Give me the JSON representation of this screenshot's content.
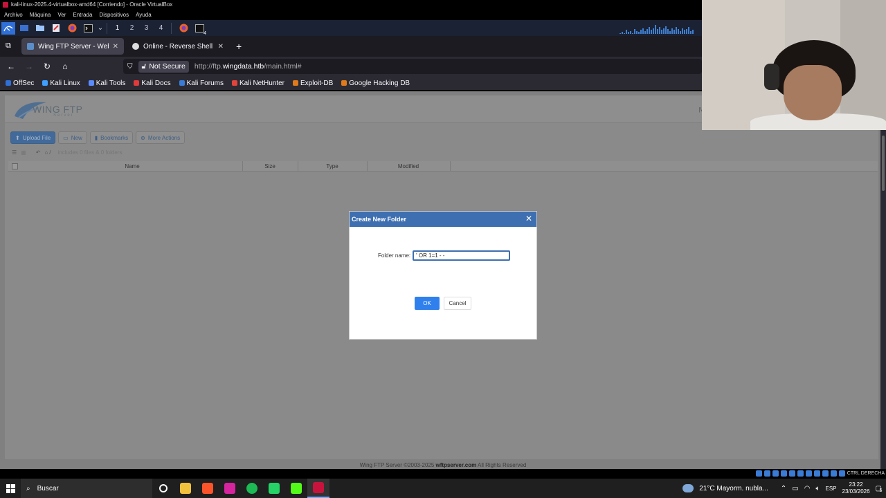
{
  "vbox": {
    "title": "kali-linux-2025.4-virtualbox-amd64 [Corriendo] - Oracle VirtualBox",
    "menu": [
      "Archivo",
      "Máquina",
      "Ver",
      "Entrada",
      "Dispositivos",
      "Ayuda"
    ]
  },
  "kali_panel": {
    "workspaces": [
      "1",
      "2",
      "3",
      "4"
    ],
    "terminal_badge": "4",
    "graph_levels": [
      0.1,
      0.2,
      0.1,
      0.4,
      0.2,
      0.3,
      0.1,
      0.5,
      0.3,
      0.2,
      0.4,
      0.6,
      0.3,
      0.5,
      0.7,
      0.4,
      0.6,
      0.9,
      0.5,
      0.7,
      0.4,
      0.6,
      0.8,
      0.5,
      0.3,
      0.6,
      0.4,
      0.7,
      0.5,
      0.3,
      0.6,
      0.4,
      0.5,
      0.7,
      0.3,
      0.4
    ]
  },
  "browser": {
    "tabs": [
      {
        "label": "Wing FTP Server - Web Cl",
        "active": true
      },
      {
        "label": "Online - Reverse Shell Ge",
        "active": false
      }
    ],
    "new_tab": "+",
    "security_label": "Not Secure",
    "url_prefix": "http://ftp.",
    "url_host": "wingdata.htb",
    "url_suffix": "/main.html#",
    "bookmarks": [
      {
        "label": "OffSec",
        "color": "#2f6fd6"
      },
      {
        "label": "Kali Linux",
        "color": "#3ea0ff"
      },
      {
        "label": "Kali Tools",
        "color": "#5b8cff"
      },
      {
        "label": "Kali Docs",
        "color": "#e03a3a"
      },
      {
        "label": "Kali Forums",
        "color": "#3a7bd5"
      },
      {
        "label": "Kali NetHunter",
        "color": "#e0443a"
      },
      {
        "label": "Exploit-DB",
        "color": "#e07a1a"
      },
      {
        "label": "Google Hacking DB",
        "color": "#e07a1a"
      }
    ]
  },
  "wing": {
    "logo_text": "WING FTP",
    "logo_sub": "Server",
    "header_right": "|W",
    "toolbar": [
      "Upload File",
      "New",
      "Bookmarks",
      "More Actions"
    ],
    "path_info": "includes 0 files & 0 folders",
    "columns": [
      "Name",
      "Size",
      "Type",
      "Modified"
    ],
    "footer_prefix": "Wing FTP Server ©2003-2025 ",
    "footer_link": "wftpserver.com",
    "footer_suffix": " All Rights Reserved"
  },
  "dialog": {
    "title": "Create New Folder",
    "field_label": "Folder name:",
    "field_value": "' OR 1=1 - -",
    "ok_label": "OK",
    "cancel_label": "Cancel"
  },
  "taskbar": {
    "search_placeholder": "Buscar",
    "weather": "21°C  Mayorm. nubla...",
    "lang": "ESP",
    "time": "23:22",
    "date": "23/03/2026",
    "notification_count": "5",
    "tray_label": "CTRL DERECHA"
  }
}
